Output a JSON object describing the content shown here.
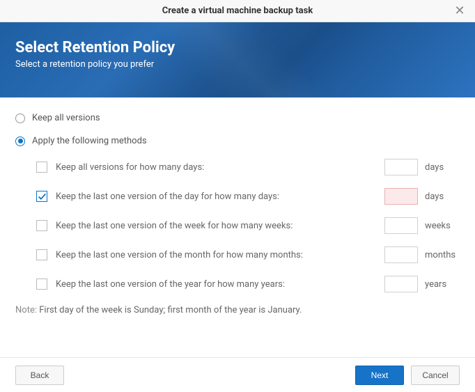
{
  "titlebar": {
    "title": "Create a virtual machine backup task"
  },
  "header": {
    "title": "Select Retention Policy",
    "subtitle": "Select a retention policy you prefer"
  },
  "options": {
    "keep_all": {
      "label": "Keep all versions",
      "selected": false
    },
    "apply_methods": {
      "label": "Apply the following methods",
      "selected": true
    }
  },
  "methods": [
    {
      "checked": false,
      "label": "Keep all versions for how many days:",
      "value": "",
      "unit": "days",
      "error": false
    },
    {
      "checked": true,
      "label": "Keep the last one version of the day for how many days:",
      "value": "",
      "unit": "days",
      "error": true
    },
    {
      "checked": false,
      "label": "Keep the last one version of the week for how many weeks:",
      "value": "",
      "unit": "weeks",
      "error": false
    },
    {
      "checked": false,
      "label": "Keep the last one version of the month for how many months:",
      "value": "",
      "unit": "months",
      "error": false
    },
    {
      "checked": false,
      "label": "Keep the last one version of the year for how many years:",
      "value": "",
      "unit": "years",
      "error": false
    }
  ],
  "note": {
    "label": "Note: ",
    "text": "First day of the week is Sunday; first month of the year is January."
  },
  "footer": {
    "back": "Back",
    "next": "Next",
    "cancel": "Cancel"
  }
}
